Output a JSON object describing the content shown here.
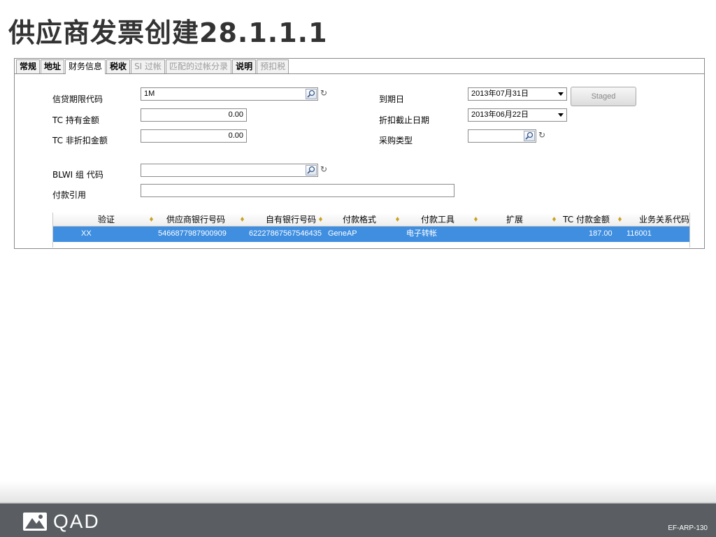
{
  "title": "供应商发票创建28.1.1.1",
  "tabs": [
    {
      "label": "常规",
      "state": "normal"
    },
    {
      "label": "地址",
      "state": "normal"
    },
    {
      "label": "财务信息",
      "state": "active"
    },
    {
      "label": "税收",
      "state": "normal"
    },
    {
      "label": "SI 过帐",
      "state": "disabled"
    },
    {
      "label": "匹配的过帐分录",
      "state": "disabled"
    },
    {
      "label": "说明",
      "state": "normal"
    },
    {
      "label": "预扣税",
      "state": "disabled"
    }
  ],
  "form": {
    "credit_terms_label": "信贷期限代码",
    "credit_terms_value": "1M",
    "tc_held_label": "TC 持有金额",
    "tc_held_value": "0.00",
    "tc_non_discount_label": "TC 非折扣金额",
    "tc_non_discount_value": "0.00",
    "blwi_label": "BLWI 组 代码",
    "blwi_value": "",
    "payment_ref_label": "付款引用",
    "payment_ref_value": "",
    "due_date_label": "到期日",
    "due_date_value": "2013年07月31日",
    "discount_date_label": "折扣截止日期",
    "discount_date_value": "2013年06月22日",
    "purchase_type_label": "采购类型",
    "purchase_type_value": "",
    "staged_button": "Staged"
  },
  "grid": {
    "columns": [
      "验证",
      "供应商银行号码",
      "自有银行号码",
      "付款格式",
      "付款工具",
      "扩展",
      "TC 付款金额",
      "业务关系代码"
    ],
    "rows": [
      [
        "XX",
        "5466877987900909",
        "62227867567546435",
        "GeneAP",
        "电子转帐",
        "",
        "187.00",
        "116001"
      ]
    ]
  },
  "footer": {
    "logo_text": "QAD",
    "slide_code": "EF-ARP-130"
  },
  "colors": {
    "selected_row": "#3f8ee0",
    "footer_bg": "#5a5e62",
    "sort_marker": "#c9a320"
  }
}
